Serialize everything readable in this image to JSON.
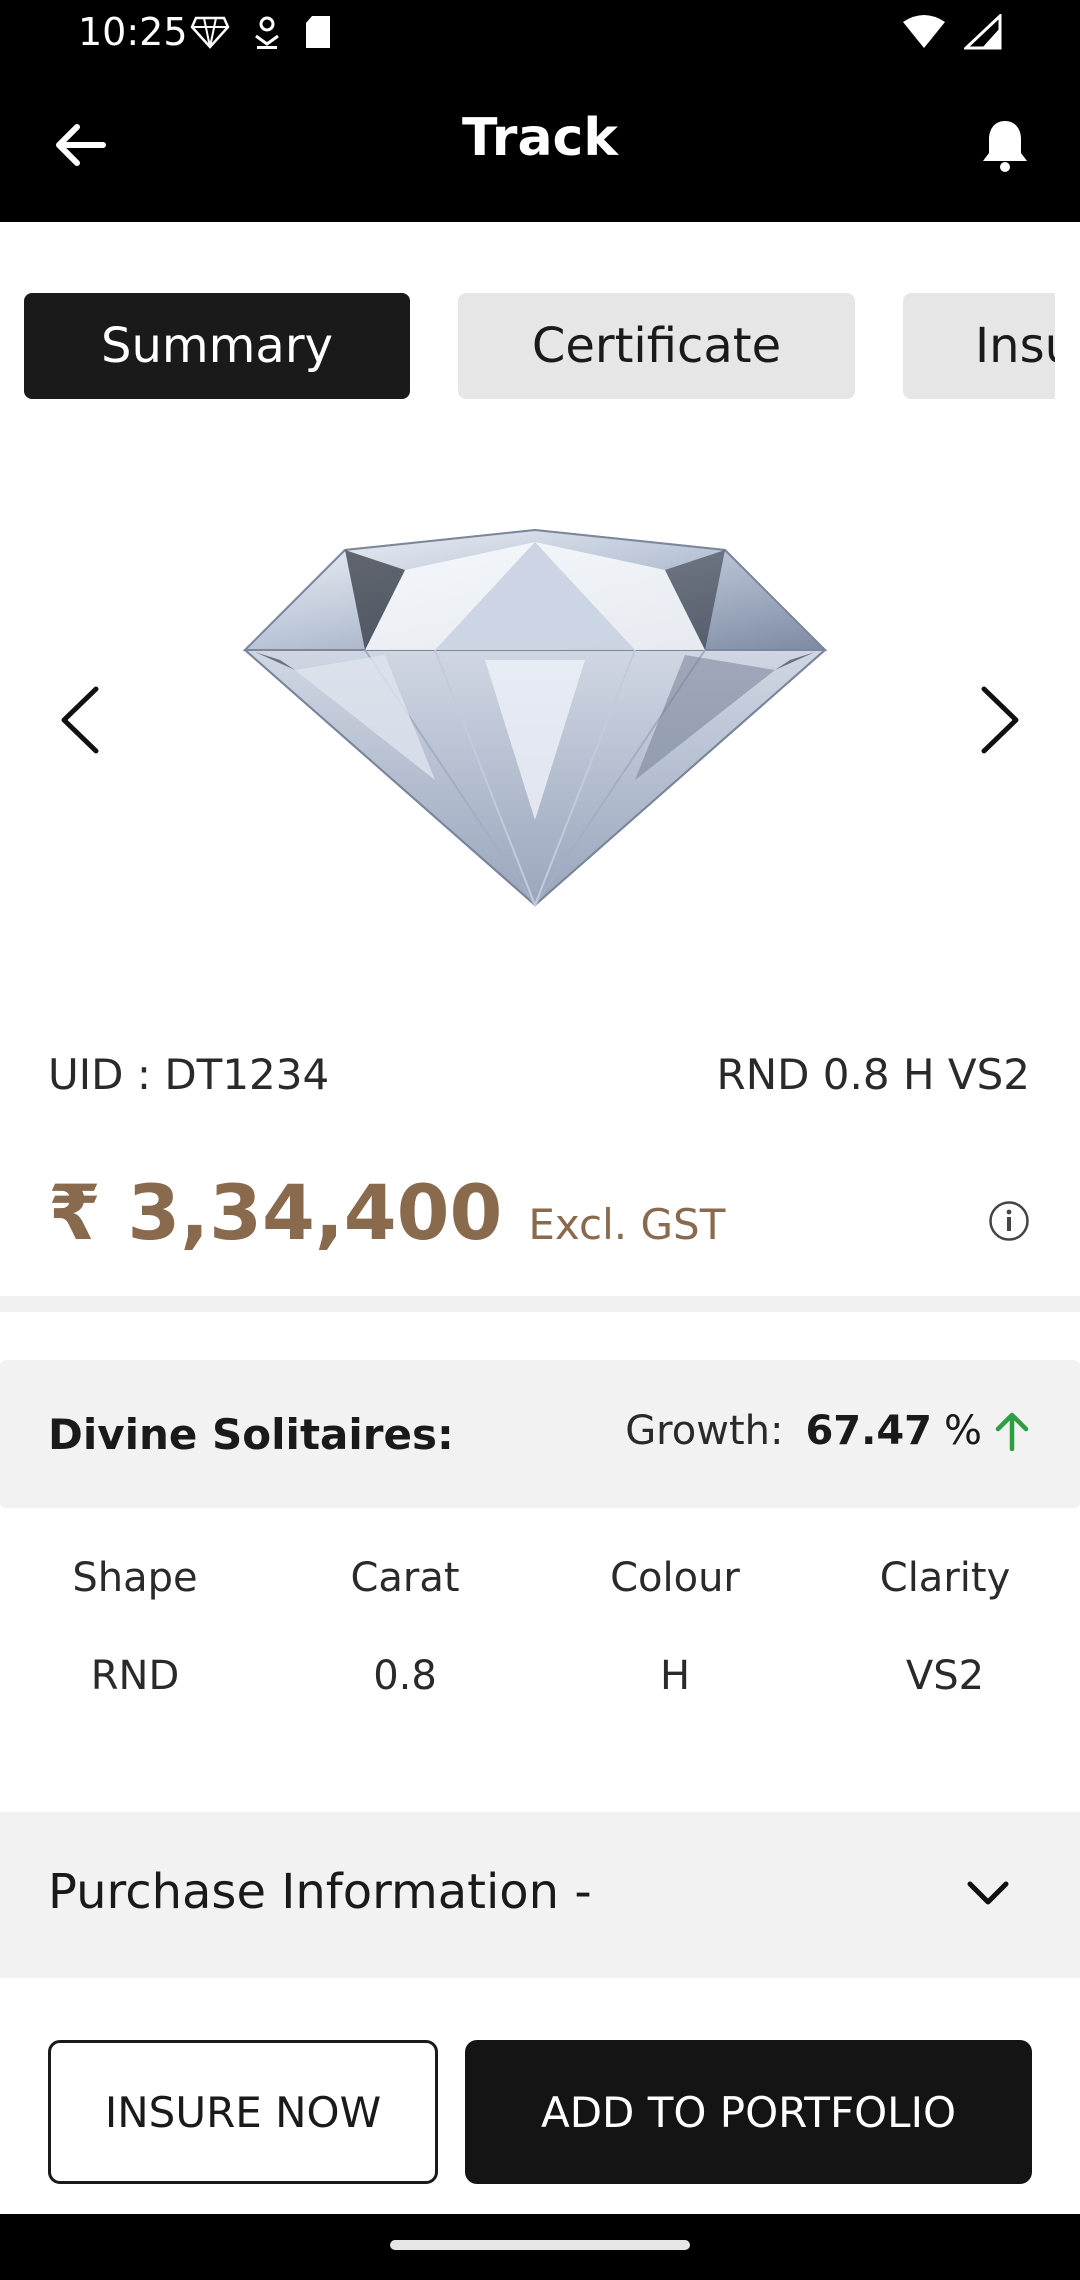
{
  "status_bar": {
    "time": "10:25",
    "icons": [
      "diamond-icon",
      "download-icon",
      "sd-card-icon",
      "wifi-icon",
      "signal-icon"
    ]
  },
  "app_bar": {
    "title": "Track",
    "back_icon": "arrow-left-icon",
    "notification_icon": "bell-icon"
  },
  "tabs": [
    {
      "label": "Summary",
      "active": true
    },
    {
      "label": "Certificate",
      "active": false
    },
    {
      "label": "Insu",
      "active": false
    }
  ],
  "carousel": {
    "prev_icon": "chevron-left-icon",
    "next_icon": "chevron-right-icon",
    "image": "diamond-image"
  },
  "item": {
    "uid": "UID : DT1234",
    "descriptor": "RND 0.8 H VS2",
    "price": "₹ 3,34,400",
    "price_note": "Excl. GST",
    "price_color": "#8a6a4c"
  },
  "growth": {
    "label": "Divine Solitaires:",
    "key": "Growth:",
    "value": "67.47",
    "unit": "%",
    "trend_icon": "arrow-up-icon",
    "trend_color": "#2e9e44"
  },
  "specs": {
    "headers": [
      "Shape",
      "Carat",
      "Colour",
      "Clarity"
    ],
    "values": [
      "RND",
      "0.8",
      "H",
      "VS2"
    ]
  },
  "purchase": {
    "label": "Purchase Information -",
    "toggle_icon": "chevron-down-icon"
  },
  "actions": {
    "insure": "INSURE NOW",
    "portfolio": "ADD TO PORTFOLIO"
  }
}
